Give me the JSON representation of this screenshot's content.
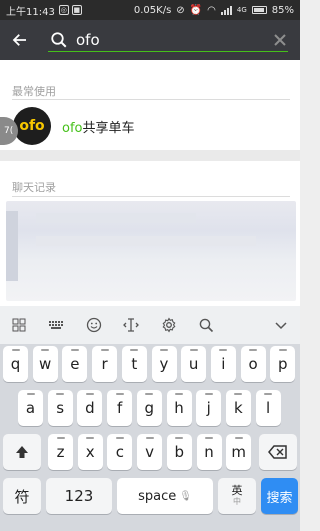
{
  "status": {
    "time": "上午11:43",
    "speed": "0.05K/s",
    "network": "4G",
    "battery": "85%"
  },
  "search": {
    "query": "ofo"
  },
  "sections": {
    "frequent": "最常使用",
    "chat": "聊天记录"
  },
  "app": {
    "logo_text": "ofo",
    "name_highlight": "ofo",
    "name_rest": "共享单车"
  },
  "bubble": {
    "text": "7("
  },
  "keyboard": {
    "row1": [
      "q",
      "w",
      "e",
      "r",
      "t",
      "y",
      "u",
      "i",
      "o",
      "p"
    ],
    "row2": [
      "a",
      "s",
      "d",
      "f",
      "g",
      "h",
      "j",
      "k",
      "l"
    ],
    "row3": [
      "z",
      "x",
      "c",
      "v",
      "b",
      "n",
      "m"
    ],
    "symbol": "符",
    "numbers": "123",
    "space": "space",
    "lang_top": "英",
    "lang_bottom": "中",
    "send": "搜索"
  },
  "colors": {
    "accent": "#45c01a",
    "send": "#2f8df3",
    "header": "#393a3f"
  }
}
